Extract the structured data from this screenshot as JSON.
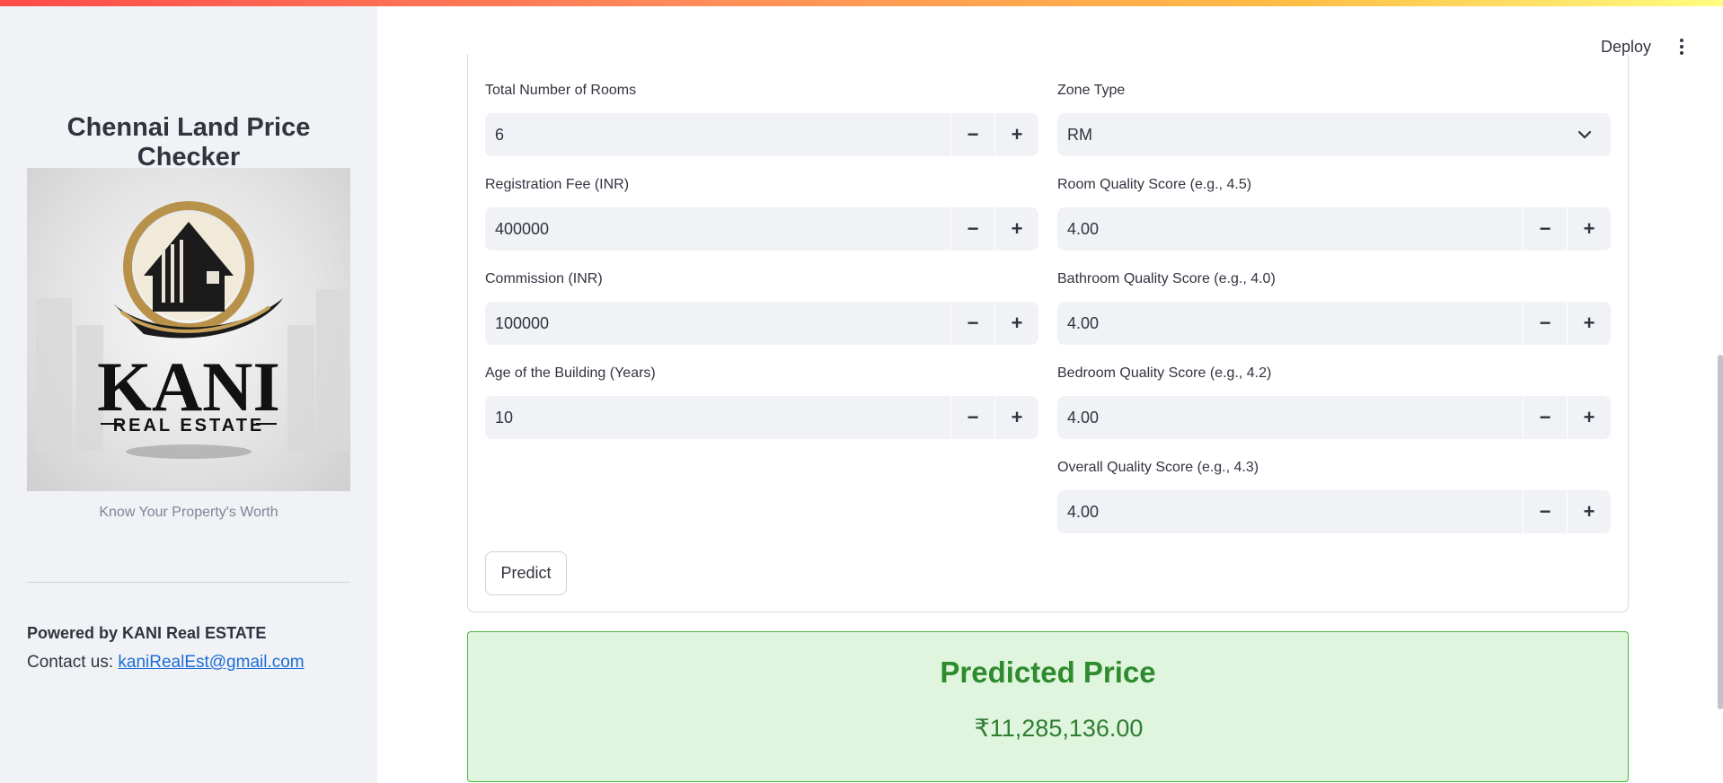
{
  "sidebar": {
    "title": "Chennai Land Price Checker",
    "logo_text": "KANI",
    "logo_subtext": "REAL ESTATE",
    "tagline": "Know Your Property's Worth",
    "powered_by": "Powered by KANI Real ESTATE",
    "contact_label": "Contact us:",
    "contact_email": "kaniRealEst@gmail.com"
  },
  "header": {
    "deploy_label": "Deploy"
  },
  "form": {
    "total_rooms": {
      "label": "Total Number of Rooms",
      "value": "6"
    },
    "zone_type": {
      "label": "Zone Type",
      "value": "RM"
    },
    "registration_fee": {
      "label": "Registration Fee (INR)",
      "value": "400000"
    },
    "room_quality": {
      "label": "Room Quality Score (e.g., 4.5)",
      "value": "4.00"
    },
    "commission": {
      "label": "Commission (INR)",
      "value": "100000"
    },
    "bathroom_quality": {
      "label": "Bathroom Quality Score (e.g., 4.0)",
      "value": "4.00"
    },
    "building_age": {
      "label": "Age of the Building (Years)",
      "value": "10"
    },
    "bedroom_quality": {
      "label": "Bedroom Quality Score (e.g., 4.2)",
      "value": "4.00"
    },
    "overall_quality": {
      "label": "Overall Quality Score (e.g., 4.3)",
      "value": "4.00"
    },
    "decrement_symbol": "−",
    "increment_symbol": "+",
    "predict_label": "Predict"
  },
  "result": {
    "title": "Predicted Price",
    "value": "₹11,285,136.00"
  },
  "colors": {
    "accent": "#ff4b4b",
    "success_bg": "#dff5dd",
    "success_text": "#2e8b2e",
    "link": "#1c6cd6"
  }
}
